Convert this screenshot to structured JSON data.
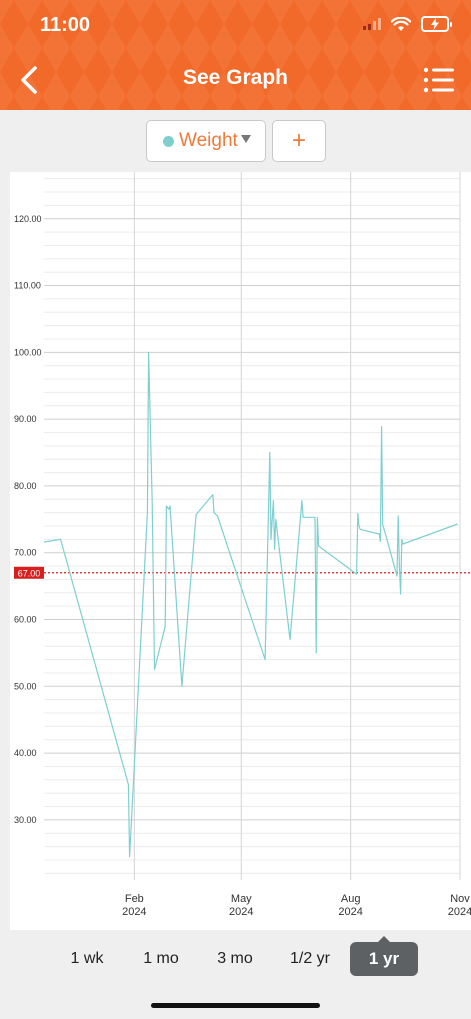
{
  "status_bar": {
    "time": "11:00"
  },
  "header": {
    "title": "See Graph",
    "back_icon": "chevron-left-icon",
    "menu_icon": "list-menu-icon"
  },
  "toolbar": {
    "metric_label": "Weight",
    "metric_dot_color": "#7fcfcf",
    "add_label": "+"
  },
  "colors": {
    "brand": "#f26a2a",
    "accent_text": "#f07a3a",
    "series": "#7fcfcf",
    "goal_line": "#d62020"
  },
  "range_options": [
    {
      "label": "1 wk",
      "active": false
    },
    {
      "label": "1 mo",
      "active": false
    },
    {
      "label": "3 mo",
      "active": false
    },
    {
      "label": "1/2 yr",
      "active": false
    },
    {
      "label": "1 yr",
      "active": true
    }
  ],
  "chart_data": {
    "type": "line",
    "title": "",
    "xlabel": "",
    "ylabel": "",
    "ylim": [
      21,
      127
    ],
    "xlim": [
      "2023-11-17",
      "2024-11-01"
    ],
    "y_ticks": [
      30,
      40,
      50,
      60,
      70,
      80,
      90,
      100,
      110,
      120
    ],
    "y_tick_labels": [
      "30.00",
      "40.00",
      "50.00",
      "60.00",
      "70.00",
      "80.00",
      "90.00",
      "100.00",
      "110.00",
      "120.00"
    ],
    "x_ticks": [
      {
        "date": "2024-02-01",
        "label": [
          "Feb",
          "2024"
        ]
      },
      {
        "date": "2024-05-01",
        "label": [
          "May",
          "2024"
        ]
      },
      {
        "date": "2024-08-01",
        "label": [
          "Aug",
          "2024"
        ]
      },
      {
        "date": "2024-11-01",
        "label": [
          "Nov",
          "2024"
        ]
      }
    ],
    "grid": true,
    "goal_line": {
      "value": 67.0,
      "label": "67.00"
    },
    "series": [
      {
        "points": [
          [
            "2023-11-17",
            71.6
          ],
          [
            "2023-12-01",
            72.0
          ],
          [
            "2024-01-27",
            35.3
          ],
          [
            "2024-01-28",
            24.5
          ],
          [
            "2024-02-12",
            76.0
          ],
          [
            "2024-02-13",
            100.0
          ],
          [
            "2024-02-16",
            77.5
          ],
          [
            "2024-02-18",
            52.5
          ],
          [
            "2024-02-27",
            59.0
          ],
          [
            "2024-02-28",
            77.0
          ],
          [
            "2024-03-01",
            76.5
          ],
          [
            "2024-03-02",
            77.0
          ],
          [
            "2024-03-12",
            50.0
          ],
          [
            "2024-03-24",
            75.7
          ],
          [
            "2024-04-07",
            78.7
          ],
          [
            "2024-04-08",
            76.0
          ],
          [
            "2024-04-11",
            75.5
          ],
          [
            "2024-05-21",
            54.0
          ],
          [
            "2024-05-25",
            85.0
          ],
          [
            "2024-05-26",
            72.0
          ],
          [
            "2024-05-28",
            77.8
          ],
          [
            "2024-05-29",
            70.5
          ],
          [
            "2024-05-30",
            75.0
          ],
          [
            "2024-06-11",
            57.0
          ],
          [
            "2024-06-21",
            77.8
          ],
          [
            "2024-06-22",
            75.3
          ],
          [
            "2024-07-02",
            75.3
          ],
          [
            "2024-07-03",
            55.0
          ],
          [
            "2024-07-04",
            75.3
          ],
          [
            "2024-07-05",
            71.0
          ],
          [
            "2024-08-06",
            66.8
          ],
          [
            "2024-08-07",
            75.9
          ],
          [
            "2024-08-08",
            74.0
          ],
          [
            "2024-08-09",
            73.5
          ],
          [
            "2024-08-25",
            72.8
          ],
          [
            "2024-08-26",
            71.7
          ],
          [
            "2024-08-27",
            88.9
          ],
          [
            "2024-08-28",
            74.2
          ],
          [
            "2024-08-30",
            73.0
          ],
          [
            "2024-09-09",
            66.5
          ],
          [
            "2024-09-10",
            75.5
          ],
          [
            "2024-09-11",
            68.0
          ],
          [
            "2024-09-12",
            63.8
          ],
          [
            "2024-09-13",
            72.0
          ],
          [
            "2024-09-14",
            71.3
          ],
          [
            "2024-10-30",
            74.3
          ]
        ]
      }
    ]
  }
}
